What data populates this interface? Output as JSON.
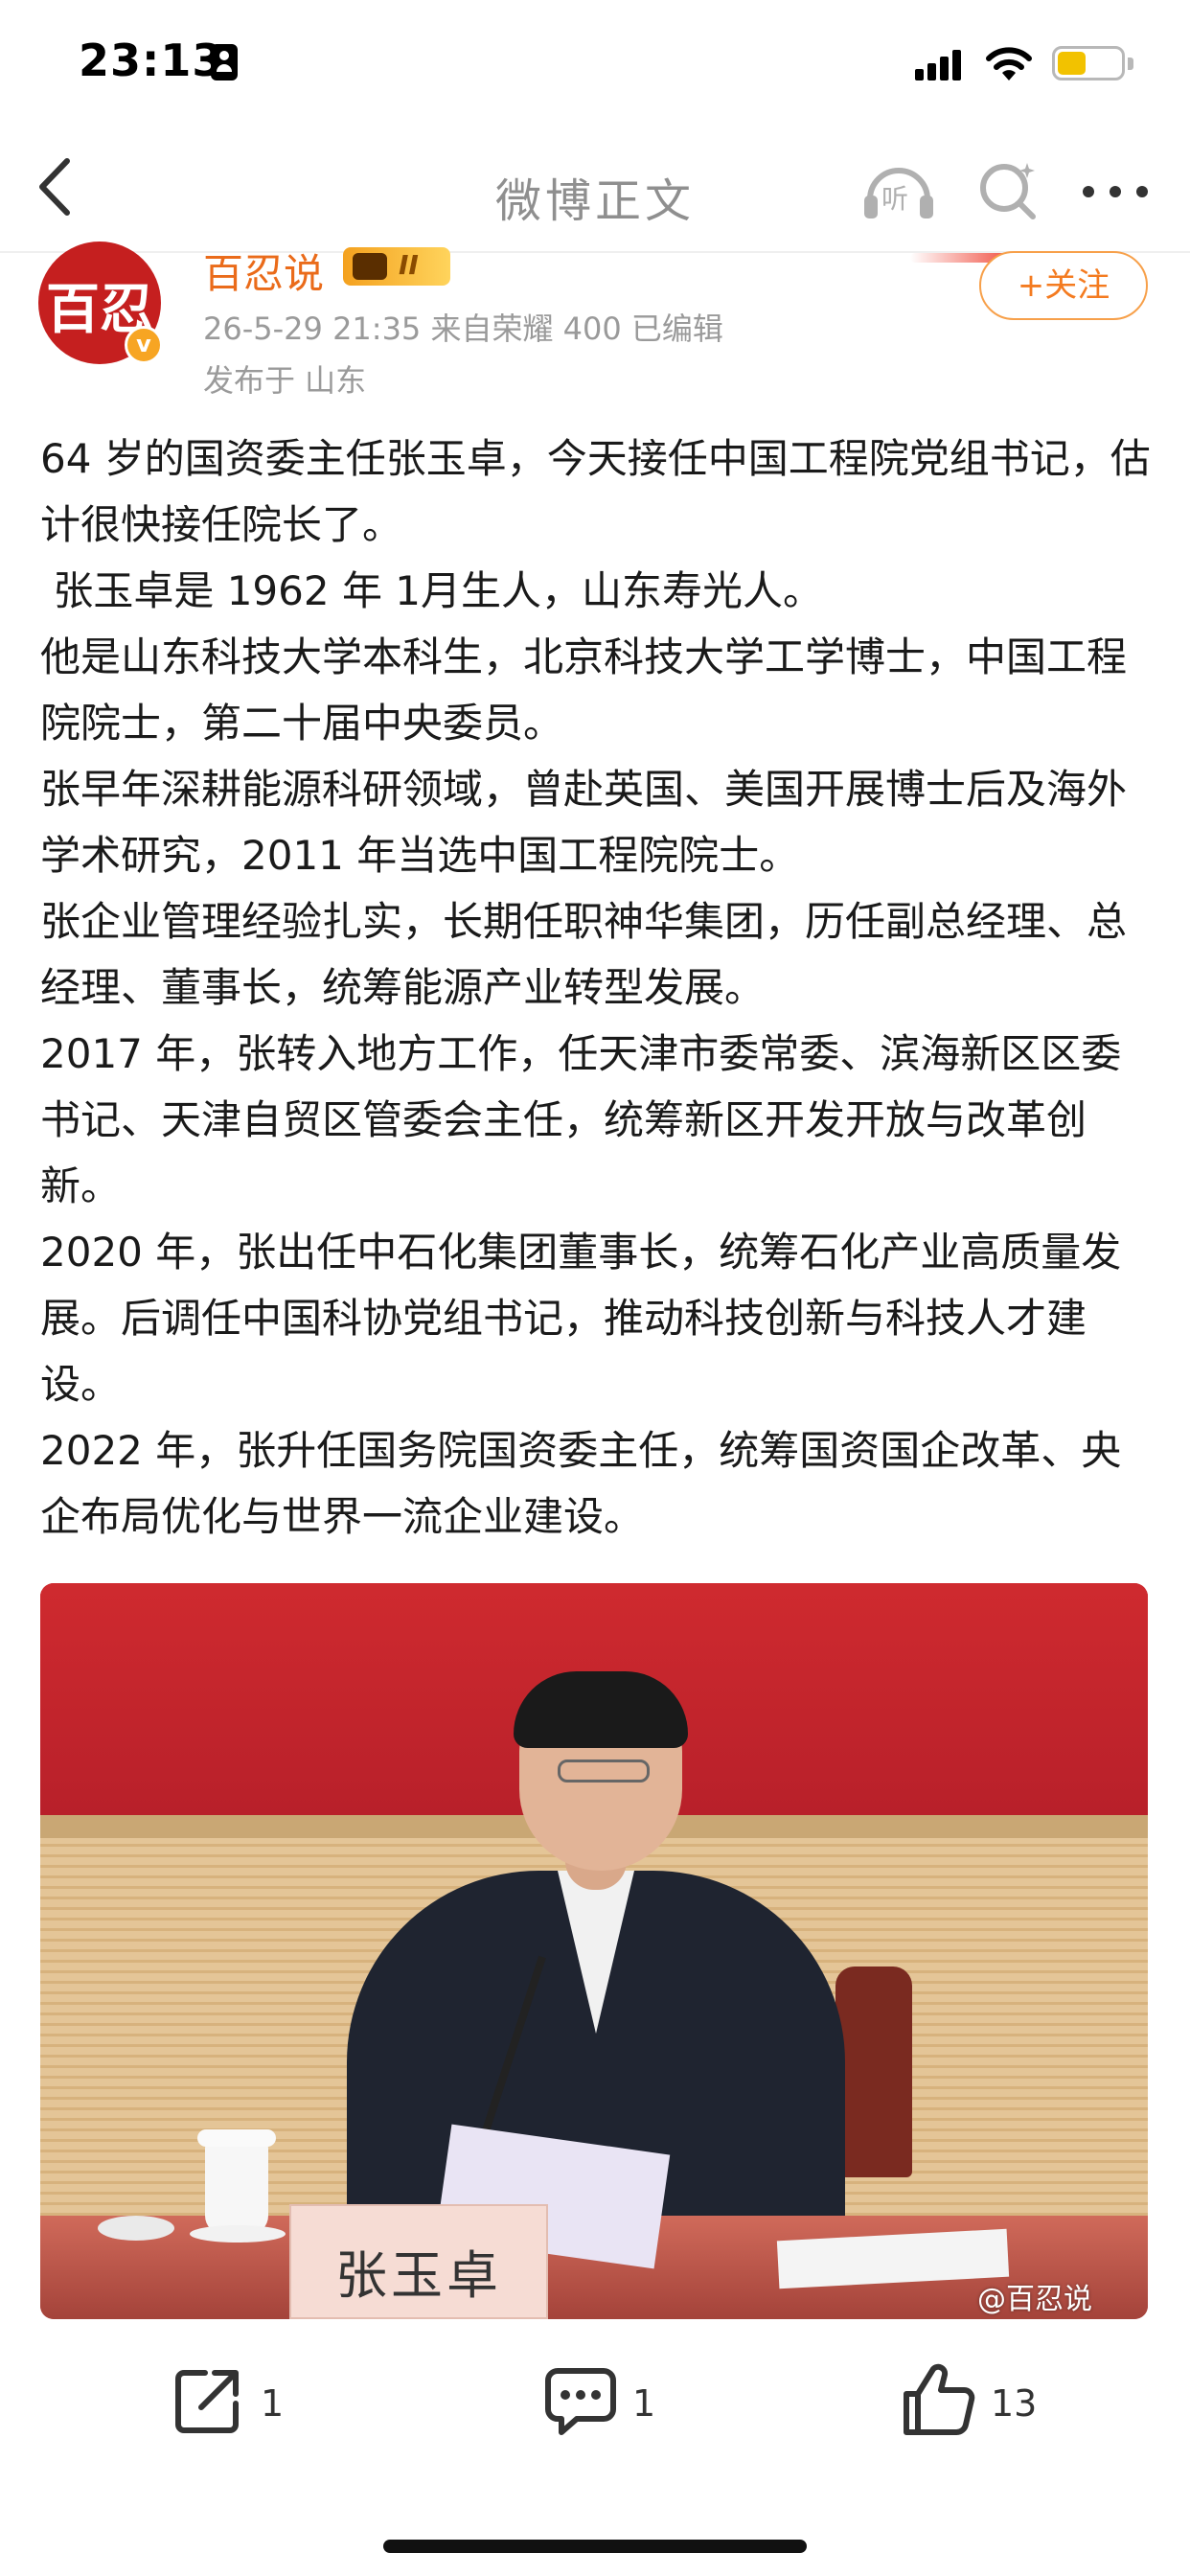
{
  "status_bar": {
    "time": "23:13",
    "battery_level": 0.45,
    "battery_color": "#f2c200"
  },
  "nav": {
    "title": "微博正文",
    "listen_label": "听",
    "icons": [
      "back-icon",
      "listen-icon",
      "search-icon",
      "more-icon"
    ]
  },
  "author": {
    "avatar_text": "百忍",
    "name": "百忍说",
    "level": "II",
    "verified_mark": "v",
    "meta": "26-5-29 21:35  来自荣耀 400  已编辑",
    "location": "发布于 山东",
    "follow_label": "+关注"
  },
  "post": {
    "paragraphs": [
      "64 岁的国资委主任张玉卓，今天接任中国工程院党组书记，估计很快接任院长了。",
      " 张玉卓是 1962 年 1月生人，山东寿光人。",
      "他是山东科技大学本科生，北京科技大学工学博士，中国工程院院士，第二十届中央委员。",
      "张早年深耕能源科研领域，曾赴英国、美国开展博士后及海外学术研究，2011 年当选中国工程院院士。",
      "张企业管理经验扎实，长期任职神华集团，历任副总经理、总经理、董事长，统筹能源产业转型发展。",
      "2017 年，张转入地方工作，任天津市委常委、滨海新区区委书记、天津自贸区管委会主任，统筹新区开发开放与改革创新。",
      "2020 年，张出任中石化集团董事长，统筹石化产业高质量发展。后调任中国科协党组书记，推动科技创新与科技人才建设。",
      "2022 年，张升任国务院国资委主任，统筹国资国企改革、央企布局优化与世界一流企业建设。"
    ],
    "image": {
      "name_plate": "张玉卓",
      "watermark": "@百忍说"
    }
  },
  "actions": {
    "share_count": "1",
    "comment_count": "1",
    "like_count": "13"
  },
  "colors": {
    "accent_orange": "#f47b20",
    "author_name": "#ea6b1a",
    "meta_gray": "#9a9a9a",
    "avatar_red": "#c51f1f"
  }
}
